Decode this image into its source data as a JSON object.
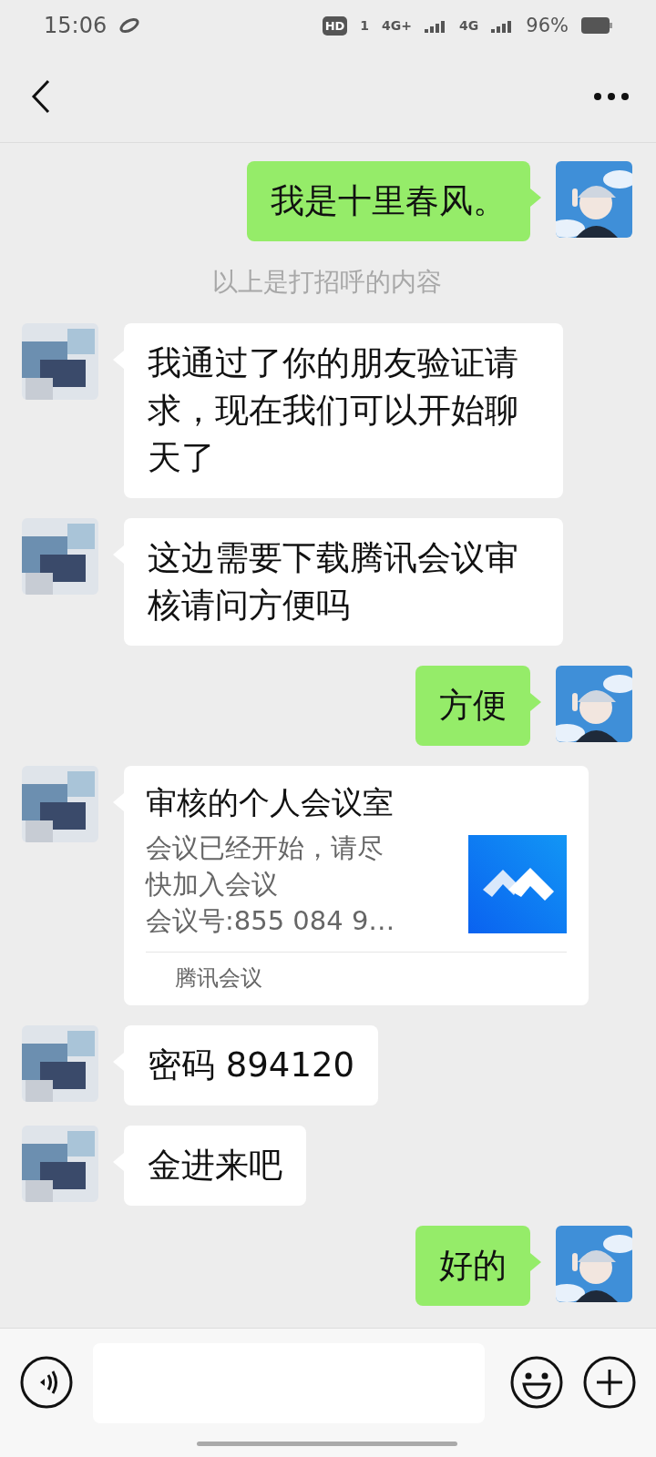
{
  "status_bar": {
    "time": "15:06",
    "hd": "HD",
    "hd_sub": "1",
    "networks": [
      "4G+",
      "4G"
    ],
    "battery": "96%"
  },
  "messages": [
    {
      "kind": "text",
      "outgoing": true,
      "text": "我是十里春风。"
    },
    {
      "kind": "system",
      "text": "以上是打招呼的内容"
    },
    {
      "kind": "text",
      "outgoing": false,
      "text": "我通过了你的朋友验证请求，现在我们可以开始聊天了"
    },
    {
      "kind": "text",
      "outgoing": false,
      "text": "这边需要下载腾讯会议审核请问方便吗"
    },
    {
      "kind": "text",
      "outgoing": true,
      "text": "方便"
    },
    {
      "kind": "card",
      "outgoing": false,
      "title": "审核的个人会议室",
      "description": "会议已经开始，请尽快加入会议",
      "meeting_number": "会议号:855 084 9…",
      "source": "腾讯会议"
    },
    {
      "kind": "text",
      "outgoing": false,
      "text": "密码 894120"
    },
    {
      "kind": "text",
      "outgoing": false,
      "text": "金进来吧"
    },
    {
      "kind": "text",
      "outgoing": true,
      "text": "好的"
    }
  ]
}
